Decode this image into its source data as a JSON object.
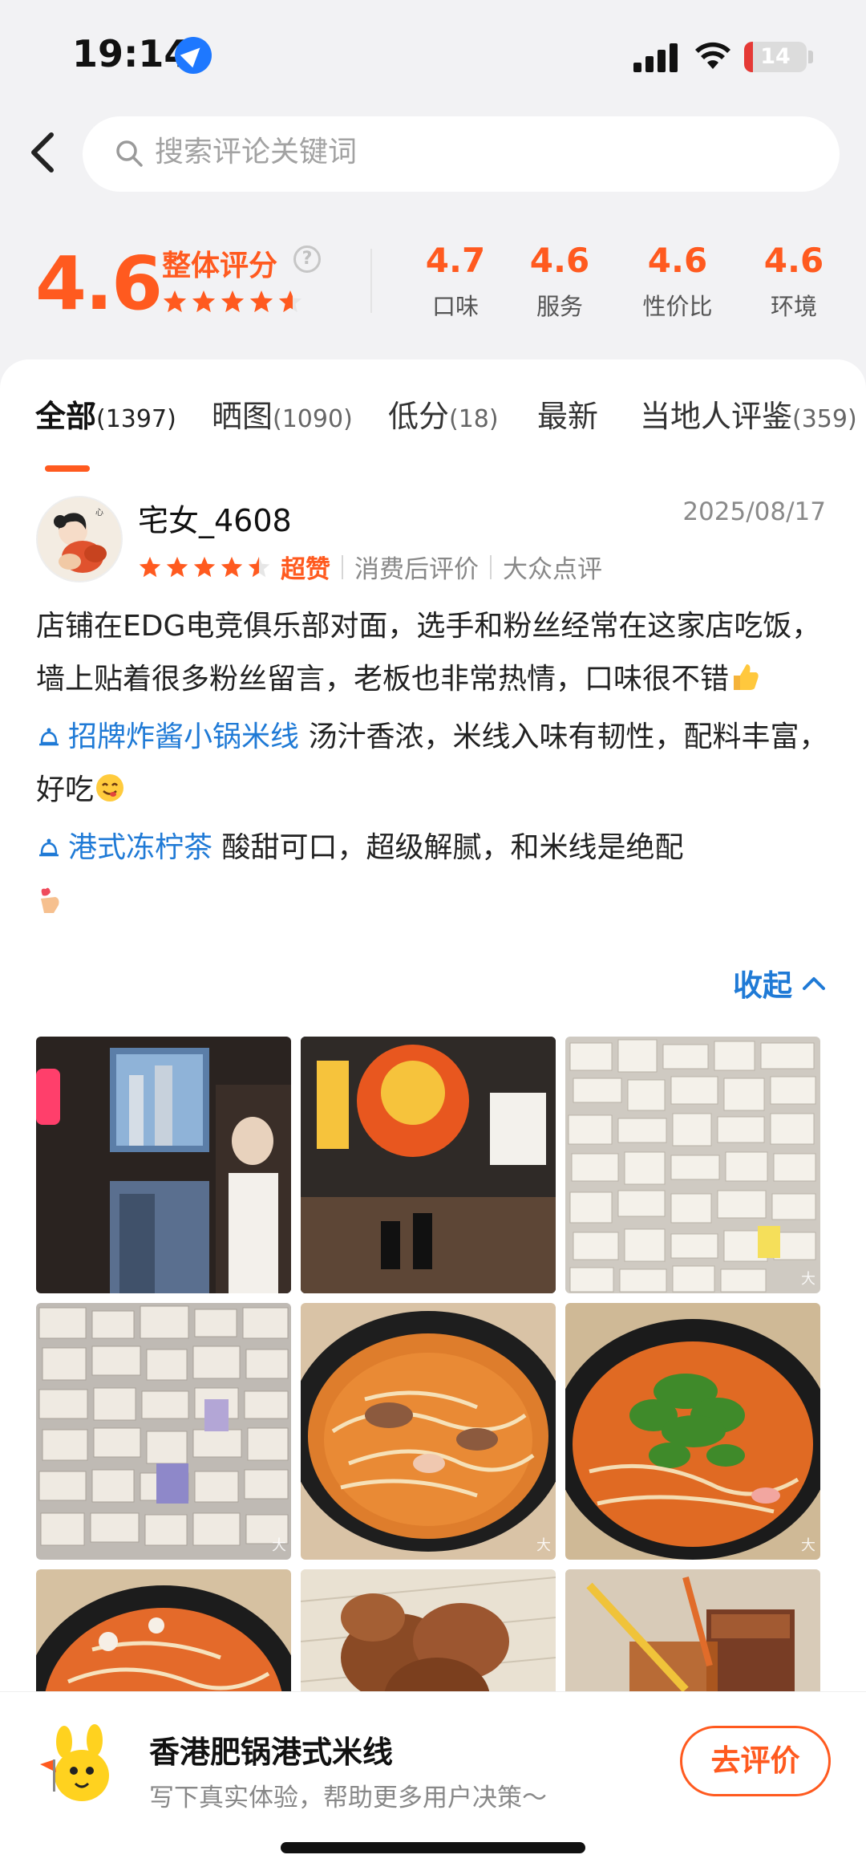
{
  "status_bar": {
    "time": "19:14",
    "battery": "14",
    "battery_level": 0.14
  },
  "search": {
    "placeholder": "搜索评论关键词"
  },
  "rating": {
    "overall_score": "4.6",
    "overall_label": "整体评分",
    "overall_stars": 4.6,
    "sub_scores": [
      {
        "value": "4.7",
        "label": "口味"
      },
      {
        "value": "4.6",
        "label": "服务"
      },
      {
        "value": "4.6",
        "label": "性价比"
      },
      {
        "value": "4.6",
        "label": "环境"
      }
    ]
  },
  "tabs": [
    {
      "label": "全部",
      "count": "(1397)",
      "active": true
    },
    {
      "label": "晒图",
      "count": "(1090)",
      "active": false
    },
    {
      "label": "低分",
      "count": "(18)",
      "active": false
    },
    {
      "label": "最新",
      "count": "",
      "active": false
    },
    {
      "label": "当地人评鉴",
      "count": "(359)",
      "active": false
    }
  ],
  "review": {
    "username": "宅女_4608",
    "date": "2025/08/17",
    "stars": 4.5,
    "rating_word": "超赞",
    "tag1": "消费后评价",
    "tag2": "大众点评",
    "text_intro": "店铺在EDG电竞俱乐部对面，选手和粉丝经常在这家店吃饭，墙上贴着很多粉丝留言，老板也非常热情，口味很不错",
    "dishes": [
      {
        "name": "招牌炸酱小锅米线",
        "comment": " 汤汁香浓，米线入味有韧性，配料丰富，好吃"
      },
      {
        "name": "港式冻柠茶",
        "comment": " 酸甜可口，超级解腻，和米线是绝配"
      }
    ],
    "collapse_label": "收起",
    "photo_watermark": "大"
  },
  "bottom_bar": {
    "shop_name": "香港肥锅港式米线",
    "subtitle": "写下真实体验，帮助更多用户决策～",
    "button_label": "去评价"
  },
  "colors": {
    "accent": "#ff5a1f",
    "link": "#1f7ad6"
  }
}
